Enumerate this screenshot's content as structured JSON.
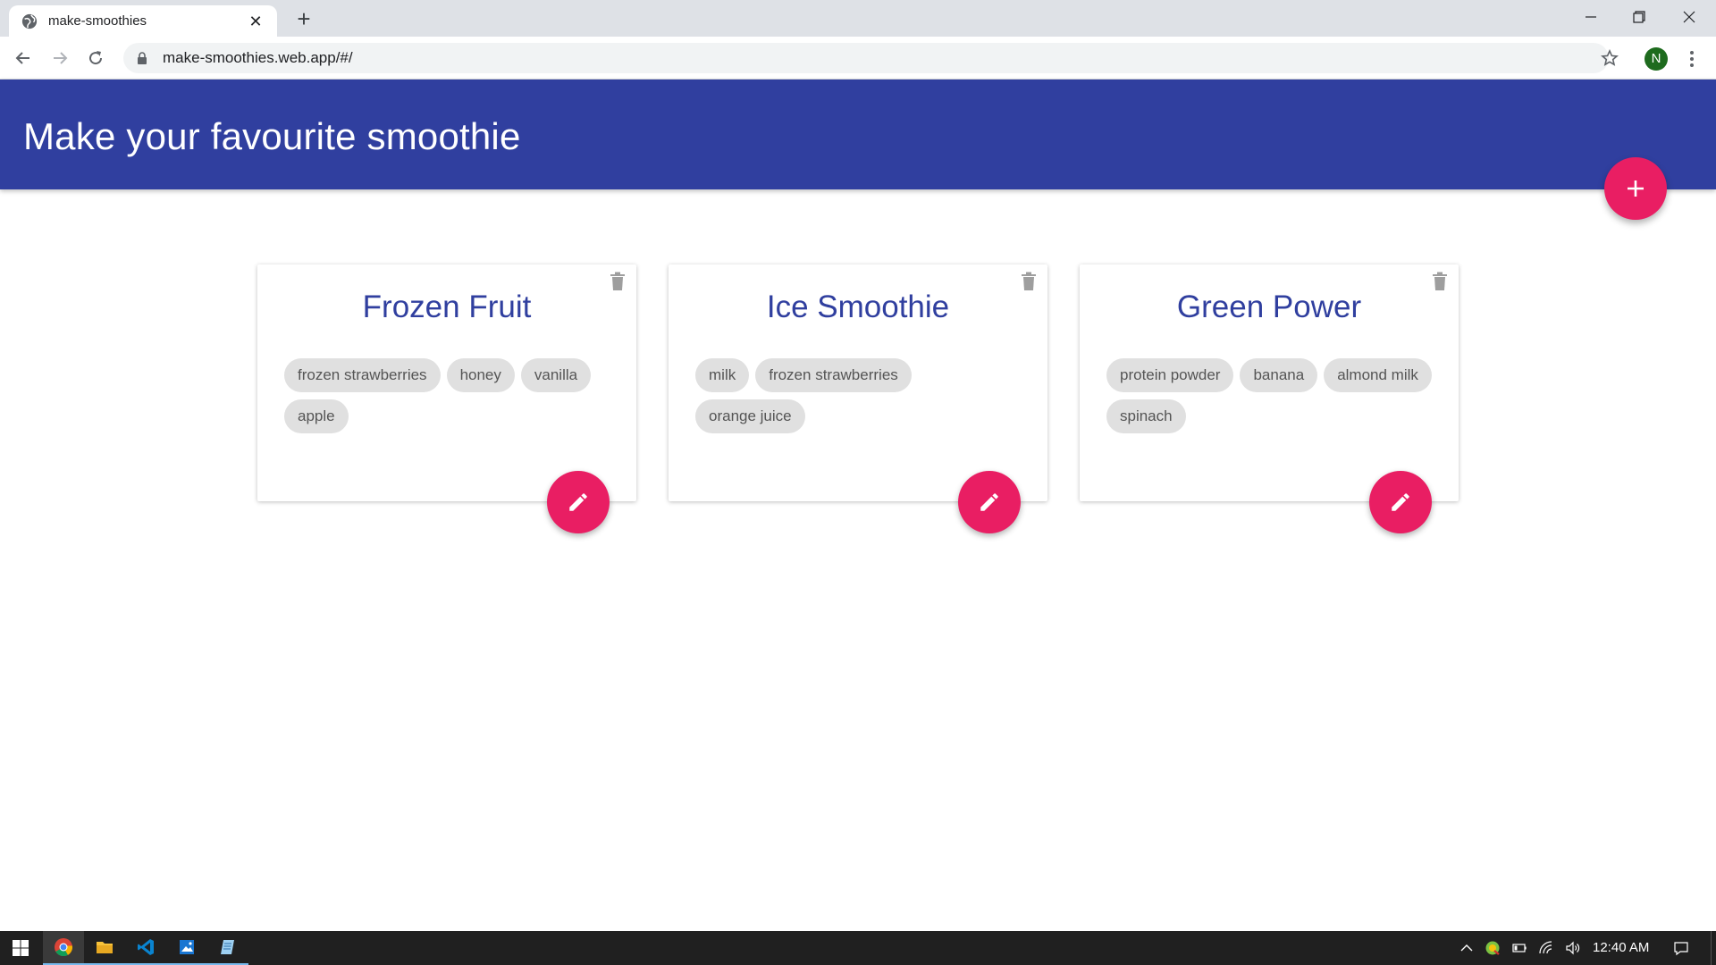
{
  "browser": {
    "tab_title": "make-smoothies",
    "url": "make-smoothies.web.app/#/",
    "profile_initial": "N",
    "tab_close_glyph": "✕",
    "new_tab_glyph": "+"
  },
  "app": {
    "title": "Make your favourite smoothie",
    "accent_color": "#e91e63",
    "primary_color": "#303f9f"
  },
  "cards": [
    {
      "title": "Frozen Fruit",
      "ingredients": [
        "frozen strawberries",
        "honey",
        "vanilla",
        "apple"
      ]
    },
    {
      "title": "Ice Smoothie",
      "ingredients": [
        "milk",
        "frozen strawberries",
        "orange juice"
      ]
    },
    {
      "title": "Green Power",
      "ingredients": [
        "protein powder",
        "banana",
        "almond milk",
        "spinach"
      ]
    }
  ],
  "taskbar": {
    "clock": "12:40 AM",
    "apps": [
      "windows-start-icon",
      "chrome-icon",
      "file-explorer-icon",
      "vscode-icon",
      "photos-icon",
      "notepad-icon"
    ]
  }
}
